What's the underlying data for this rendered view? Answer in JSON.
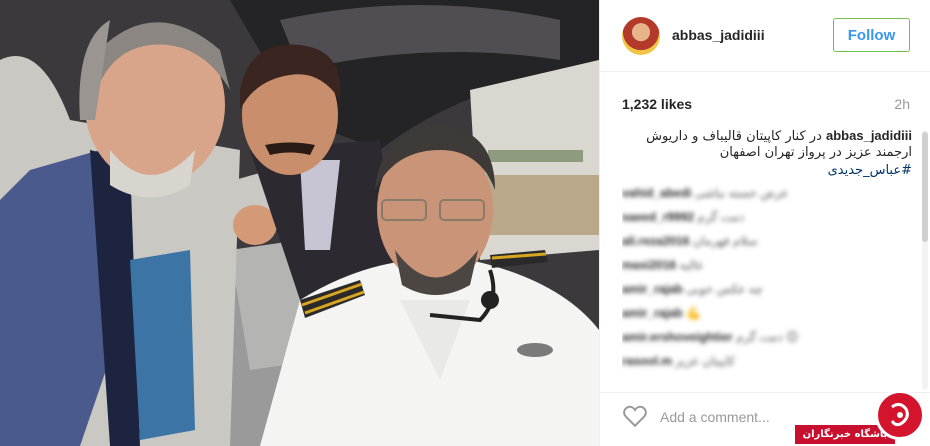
{
  "post": {
    "username": "abbas_jadidiii",
    "follow_label": "Follow",
    "likes": "1,232 likes",
    "time_ago": "2h",
    "caption_user": "abbas_jadidiii",
    "caption_text": "در کنار کاپیتان قالیباف و داریوش ارجمند عزیز در پرواز تهران اصفهان",
    "hashtag": "#عباس_جدیدی",
    "comment_placeholder": "Add a comment...",
    "comments": [
      {
        "user": "vahid_abedi",
        "text": "عرض خسته نباشی"
      },
      {
        "user": "saeed_r9992",
        "text": "دمت گرم"
      },
      {
        "user": "ali.reza2016",
        "text": "سلام قهرمان"
      },
      {
        "user": "masi2016",
        "text": "عالیه"
      },
      {
        "user": "amir_rajab",
        "text": "چه عکس خوبی"
      },
      {
        "user": "amir_rajab",
        "text": "💪"
      },
      {
        "user": "amir.ershoveightier",
        "text": "دمت گرم 😊"
      },
      {
        "user": "rasool.m",
        "text": "کاپیتان عزیز"
      }
    ]
  },
  "watermark": {
    "label": "باشگاه خبرنگاران"
  },
  "colors": {
    "follow_text": "#3897f0",
    "follow_border": "#70c050",
    "hashtag": "#003569",
    "watermark_red": "#c8102e"
  },
  "icons": {
    "like": "heart-outline-icon"
  }
}
